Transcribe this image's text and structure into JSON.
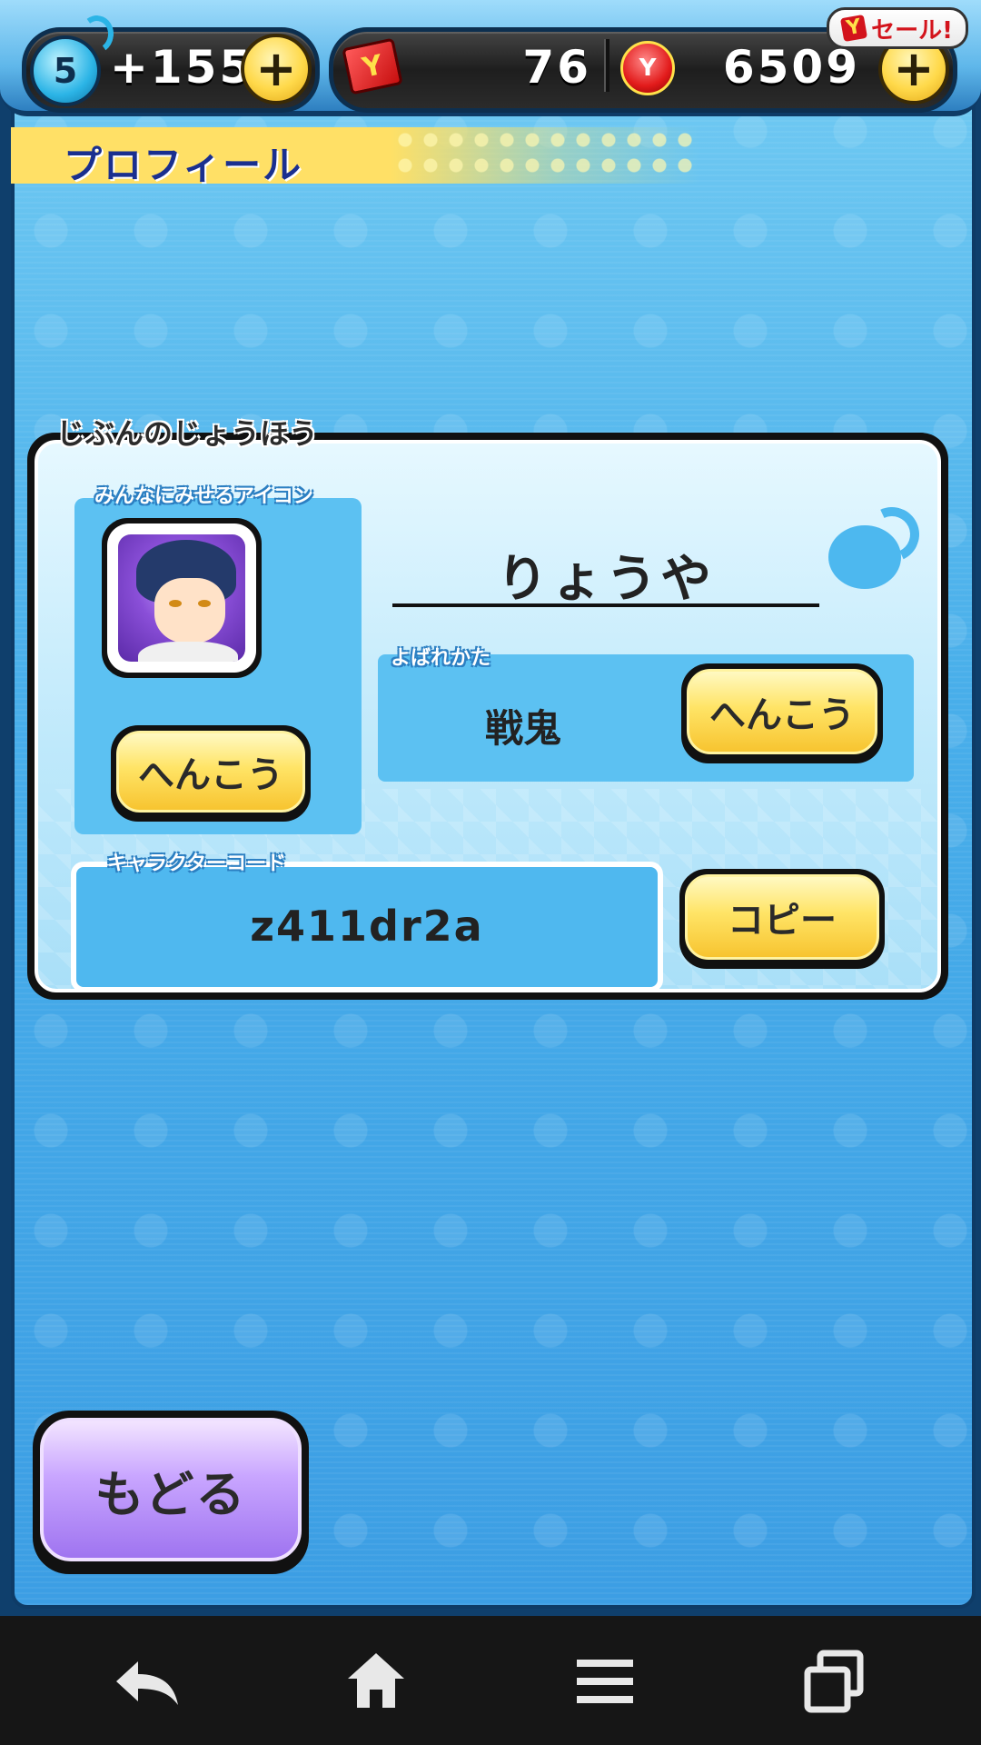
{
  "header": {
    "spirit_level": "5",
    "spirit_points": "+155",
    "tickets": "76",
    "money": "6509",
    "sale_label": "セール!",
    "sale_icon_letter": "Y",
    "ticket_icon_letter": "Y",
    "money_icon_letter": "Y",
    "plus_symbol": "+"
  },
  "page": {
    "title": "プロフィール"
  },
  "profile": {
    "section_label": "じぶんのじょうほう",
    "icon_label": "みんなにみせるアイコン",
    "icon_change_label": "へんこう",
    "player_name": "りょうや",
    "title_label": "よばれかた",
    "title_value": "戦鬼",
    "title_change_label": "へんこう",
    "code_label": "キャラクターコード",
    "code_value": "z411dr2a",
    "copy_label": "コピー"
  },
  "footer": {
    "back_label": "もどる"
  },
  "navbar": {
    "items": [
      "back-icon",
      "home-icon",
      "menu-icon",
      "recent-apps-icon"
    ]
  },
  "colors": {
    "accent_yellow": "#ffe466",
    "panel_blue": "#5cc1f2",
    "back_purple": "#c9a6ff"
  }
}
